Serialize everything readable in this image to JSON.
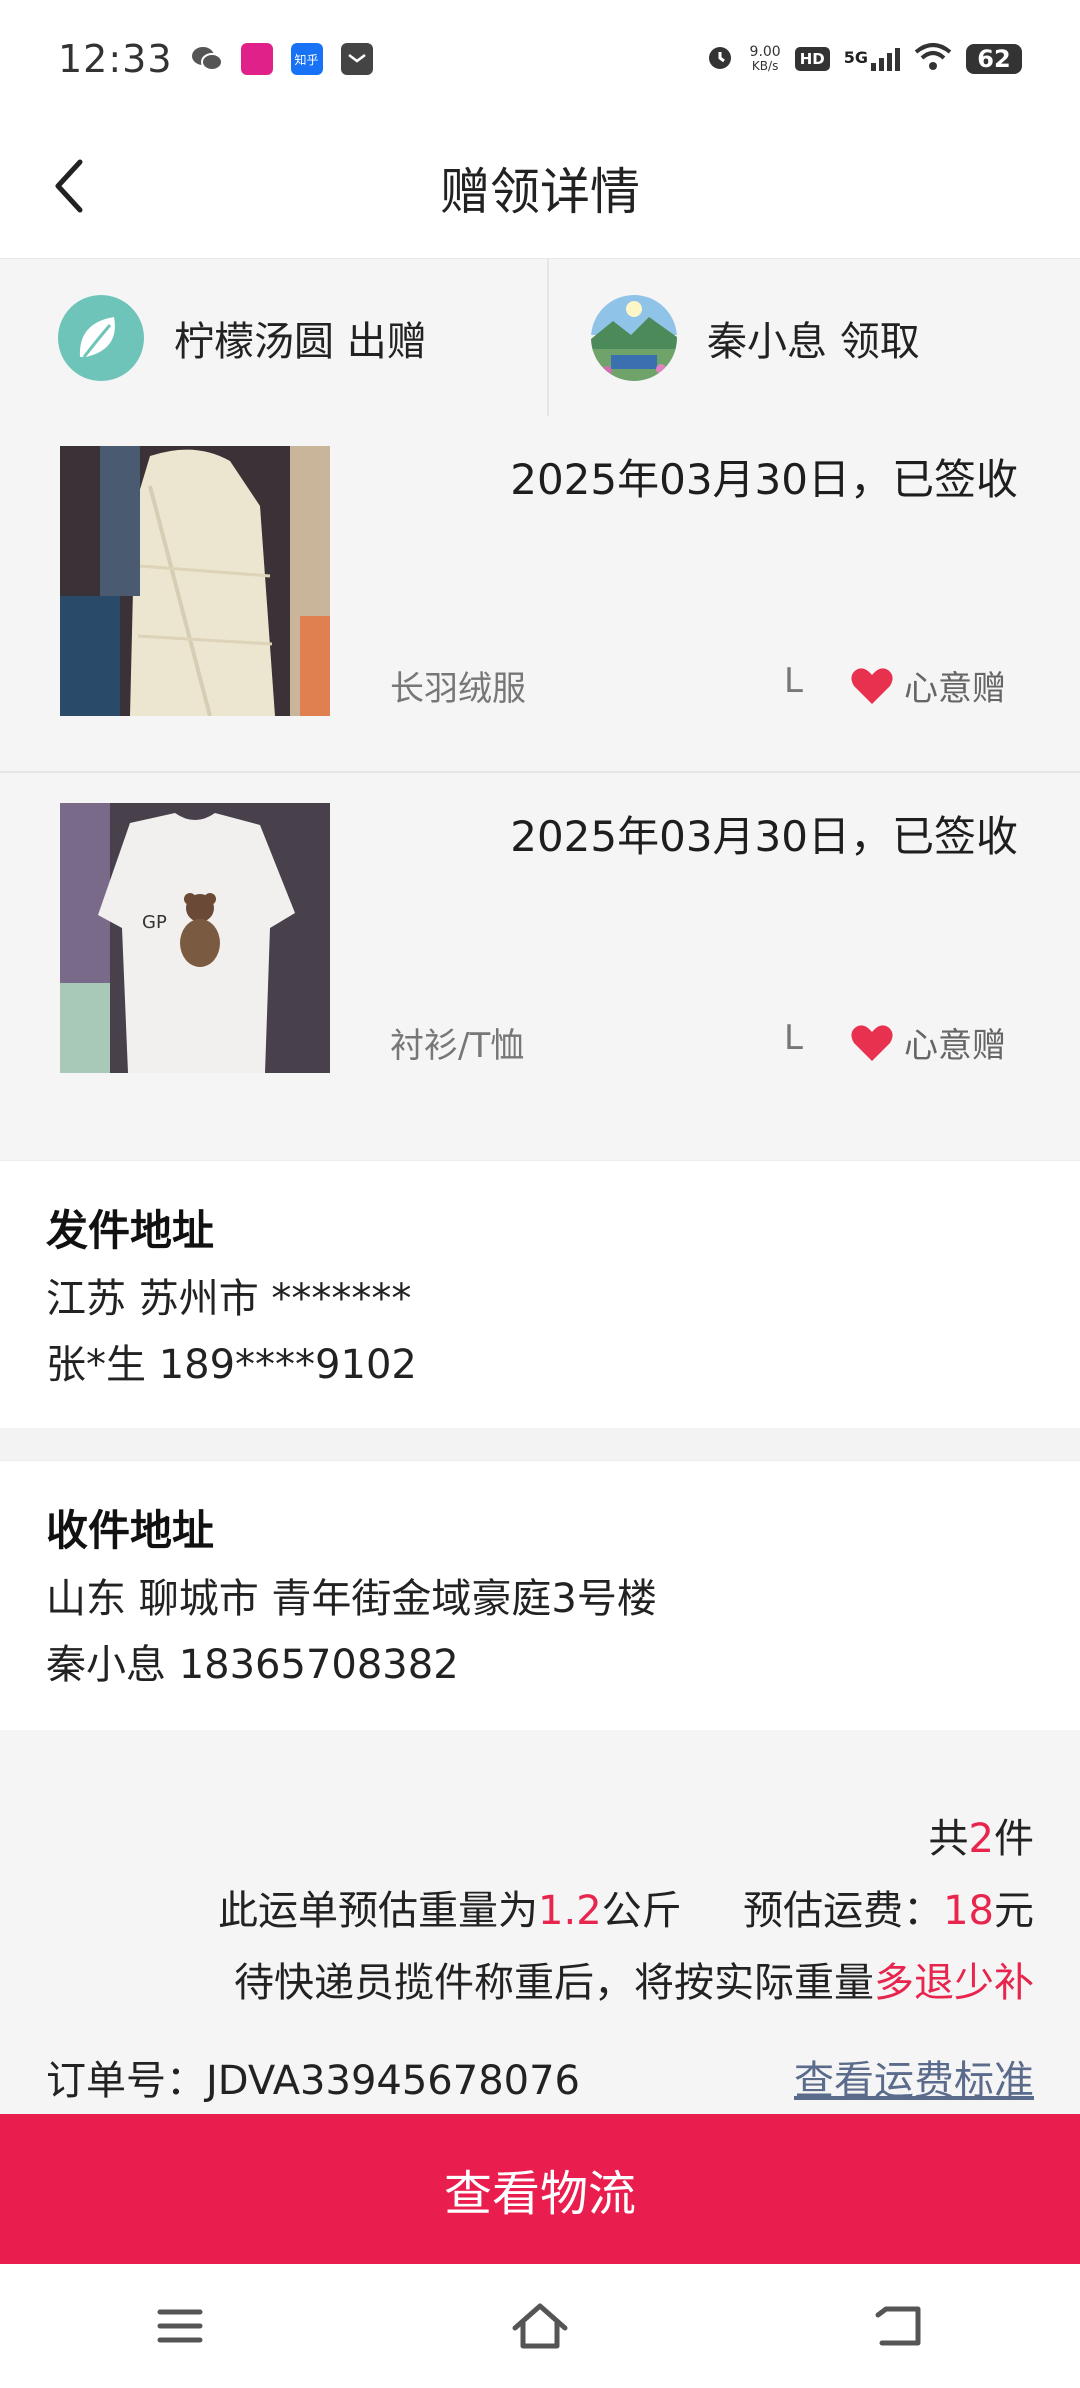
{
  "status_bar": {
    "time": "12:33",
    "net_speed_value": "9.00",
    "net_speed_unit": "KB/s",
    "hd_label": "HD",
    "network": "5G",
    "battery": "62",
    "app_icon_zhihu": "知乎"
  },
  "header": {
    "title": "赠领详情"
  },
  "parties": {
    "giver": "柠檬汤圆 出赠",
    "receiver": "秦小息 领取"
  },
  "items": [
    {
      "date_status": "2025年03月30日，已签收",
      "name": "长羽绒服",
      "size": "L",
      "tag": "心意赠"
    },
    {
      "date_status": "2025年03月30日，已签收",
      "name": "衬衫/T恤",
      "size": "L",
      "tag": "心意赠"
    }
  ],
  "sender": {
    "title": "发件地址",
    "region": "江苏 苏州市 *******",
    "contact": "张*生 189****9102"
  },
  "receiver": {
    "title": "收件地址",
    "address": "山东 聊城市 青年街金域豪庭3号楼",
    "contact": "秦小息 18365708382"
  },
  "summary": {
    "count_prefix": "共",
    "count": "2",
    "count_suffix": "件",
    "weight_prefix": "此运单预估重量为",
    "weight": "1.2",
    "weight_unit": "公斤",
    "fee_label": "预估运费：",
    "fee": "18",
    "fee_unit": "元",
    "note_prefix": "待快递员揽件称重后，将按实际重量",
    "note_highlight": "多退少补",
    "order_no": "订单号：JDVA33945678076",
    "fee_standard_link": "查看运费标准"
  },
  "actions": {
    "primary": "查看物流"
  },
  "colors": {
    "accent": "#e91e4f",
    "highlight": "#e8254d",
    "link": "#5a6b8c",
    "heart": "#e8304f"
  }
}
